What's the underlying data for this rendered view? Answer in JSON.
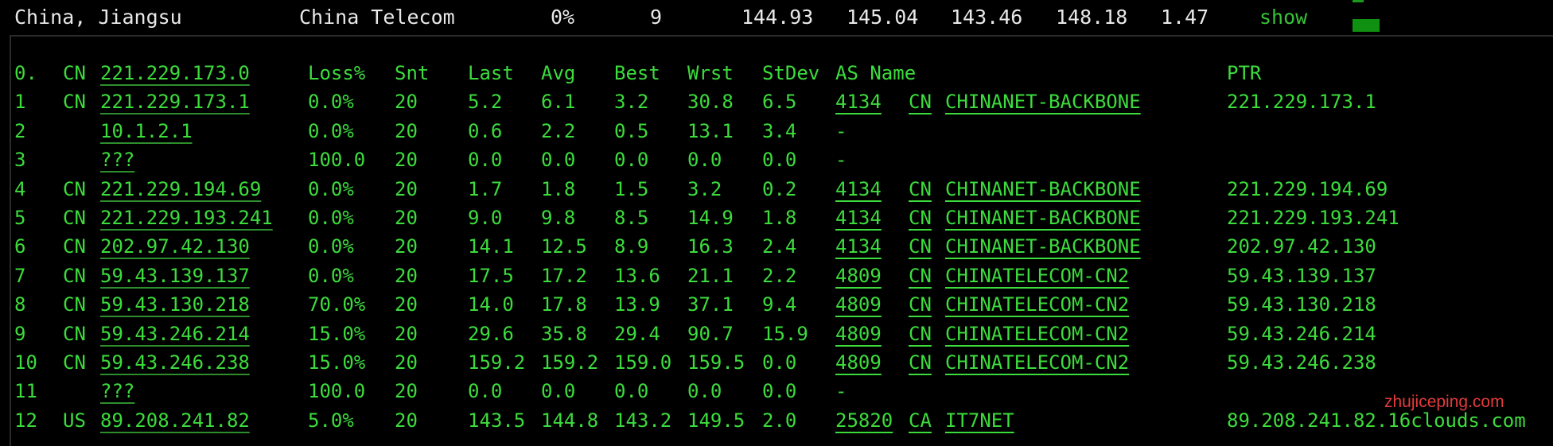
{
  "summary": {
    "location": "China, Jiangsu",
    "isp": "China Telecom",
    "loss": "0%",
    "sent": "9",
    "last": "144.93",
    "avg": "145.04",
    "best": "143.46",
    "worst": "148.18",
    "stdev": "1.47",
    "action": "show"
  },
  "trace": {
    "header": {
      "hop": "0.",
      "country": "CN",
      "ip": "221.229.173.0",
      "loss": "Loss%",
      "snt": "Snt",
      "last": "Last",
      "avg": "Avg",
      "best": "Best",
      "wrst": "Wrst",
      "stdev": "StDev",
      "as_name": "AS Name",
      "ptr": "PTR"
    },
    "hops": [
      {
        "hop": "1",
        "country": "CN",
        "ip": "221.229.173.1",
        "loss": "0.0%",
        "snt": "20",
        "last": "5.2",
        "avg": "6.1",
        "best": "3.2",
        "wrst": "30.8",
        "stdev": "6.5",
        "asn": "4134",
        "as_cc": "CN",
        "as_name": "CHINANET-BACKBONE",
        "ptr": "221.229.173.1"
      },
      {
        "hop": "2",
        "country": "",
        "ip": "10.1.2.1",
        "loss": "0.0%",
        "snt": "20",
        "last": "0.6",
        "avg": "2.2",
        "best": "0.5",
        "wrst": "13.1",
        "stdev": "3.4",
        "asn": "-",
        "as_cc": "",
        "as_name": "",
        "ptr": ""
      },
      {
        "hop": "3",
        "country": "",
        "ip": "???",
        "loss": "100.0",
        "snt": "20",
        "last": "0.0",
        "avg": "0.0",
        "best": "0.0",
        "wrst": "0.0",
        "stdev": "0.0",
        "asn": "-",
        "as_cc": "",
        "as_name": "",
        "ptr": ""
      },
      {
        "hop": "4",
        "country": "CN",
        "ip": "221.229.194.69",
        "loss": "0.0%",
        "snt": "20",
        "last": "1.7",
        "avg": "1.8",
        "best": "1.5",
        "wrst": "3.2",
        "stdev": "0.2",
        "asn": "4134",
        "as_cc": "CN",
        "as_name": "CHINANET-BACKBONE",
        "ptr": "221.229.194.69"
      },
      {
        "hop": "5",
        "country": "CN",
        "ip": "221.229.193.241",
        "loss": "0.0%",
        "snt": "20",
        "last": "9.0",
        "avg": "9.8",
        "best": "8.5",
        "wrst": "14.9",
        "stdev": "1.8",
        "asn": "4134",
        "as_cc": "CN",
        "as_name": "CHINANET-BACKBONE",
        "ptr": "221.229.193.241"
      },
      {
        "hop": "6",
        "country": "CN",
        "ip": "202.97.42.130",
        "loss": "0.0%",
        "snt": "20",
        "last": "14.1",
        "avg": "12.5",
        "best": "8.9",
        "wrst": "16.3",
        "stdev": "2.4",
        "asn": "4134",
        "as_cc": "CN",
        "as_name": "CHINANET-BACKBONE",
        "ptr": "202.97.42.130"
      },
      {
        "hop": "7",
        "country": "CN",
        "ip": "59.43.139.137",
        "loss": "0.0%",
        "snt": "20",
        "last": "17.5",
        "avg": "17.2",
        "best": "13.6",
        "wrst": "21.1",
        "stdev": "2.2",
        "asn": "4809",
        "as_cc": "CN",
        "as_name": "CHINATELECOM-CN2",
        "ptr": "59.43.139.137"
      },
      {
        "hop": "8",
        "country": "CN",
        "ip": "59.43.130.218",
        "loss": "70.0%",
        "snt": "20",
        "last": "14.0",
        "avg": "17.8",
        "best": "13.9",
        "wrst": "37.1",
        "stdev": "9.4",
        "asn": "4809",
        "as_cc": "CN",
        "as_name": "CHINATELECOM-CN2",
        "ptr": "59.43.130.218"
      },
      {
        "hop": "9",
        "country": "CN",
        "ip": "59.43.246.214",
        "loss": "15.0%",
        "snt": "20",
        "last": "29.6",
        "avg": "35.8",
        "best": "29.4",
        "wrst": "90.7",
        "stdev": "15.9",
        "asn": "4809",
        "as_cc": "CN",
        "as_name": "CHINATELECOM-CN2",
        "ptr": "59.43.246.214"
      },
      {
        "hop": "10",
        "country": "CN",
        "ip": "59.43.246.238",
        "loss": "15.0%",
        "snt": "20",
        "last": "159.2",
        "avg": "159.2",
        "best": "159.0",
        "wrst": "159.5",
        "stdev": "0.0",
        "asn": "4809",
        "as_cc": "CN",
        "as_name": "CHINATELECOM-CN2",
        "ptr": "59.43.246.238"
      },
      {
        "hop": "11",
        "country": "",
        "ip": "???",
        "loss": "100.0",
        "snt": "20",
        "last": "0.0",
        "avg": "0.0",
        "best": "0.0",
        "wrst": "0.0",
        "stdev": "0.0",
        "asn": "-",
        "as_cc": "",
        "as_name": "",
        "ptr": ""
      },
      {
        "hop": "12",
        "country": "US",
        "ip": "89.208.241.82",
        "loss": "5.0%",
        "snt": "20",
        "last": "143.5",
        "avg": "144.8",
        "best": "143.2",
        "wrst": "149.5",
        "stdev": "2.0",
        "asn": "25820",
        "as_cc": "CA",
        "as_name": "IT7NET",
        "ptr": "89.208.241.82.16clouds.com"
      }
    ]
  },
  "watermark": "zhujiceping.com",
  "colors": {
    "background": "#000000",
    "summary_text": "#e8e8e8",
    "trace_text": "#3cdc3c",
    "accent_bar": "#109010",
    "watermark": "#e23b3b"
  }
}
